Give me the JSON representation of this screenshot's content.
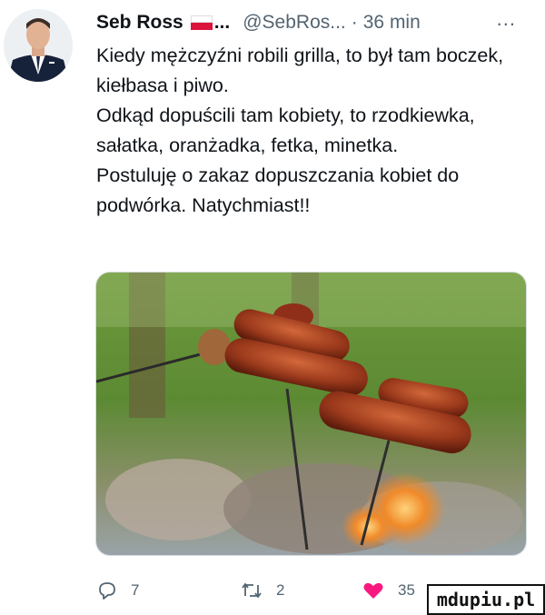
{
  "tweet": {
    "author_name": "Seb Ross",
    "name_ellipsis": "...",
    "handle": "@SebRos...",
    "separator": "·",
    "time": "36 min",
    "more_label": "...",
    "text_lines": [
      "Kiedy mężczyźni robili grilla, to był tam boczek, kiełbasa i piwo.",
      "Odkąd dopuścili tam kobiety, to rzodkiewka, sałatka, oranżadka, fetka, minetka.",
      "Postuluję o zakaz dopuszczania kobiet do podwórka. Natychmiast!!"
    ]
  },
  "actions": {
    "reply_count": "7",
    "retweet_count": "2",
    "like_count": "35",
    "like_color": "#f91880"
  },
  "icons": {
    "reply": "speech-bubble-icon",
    "retweet": "retweet-arrows-icon",
    "like": "heart-icon",
    "more": "more-dots-icon"
  },
  "watermark": {
    "text": "mdupiu.pl"
  }
}
